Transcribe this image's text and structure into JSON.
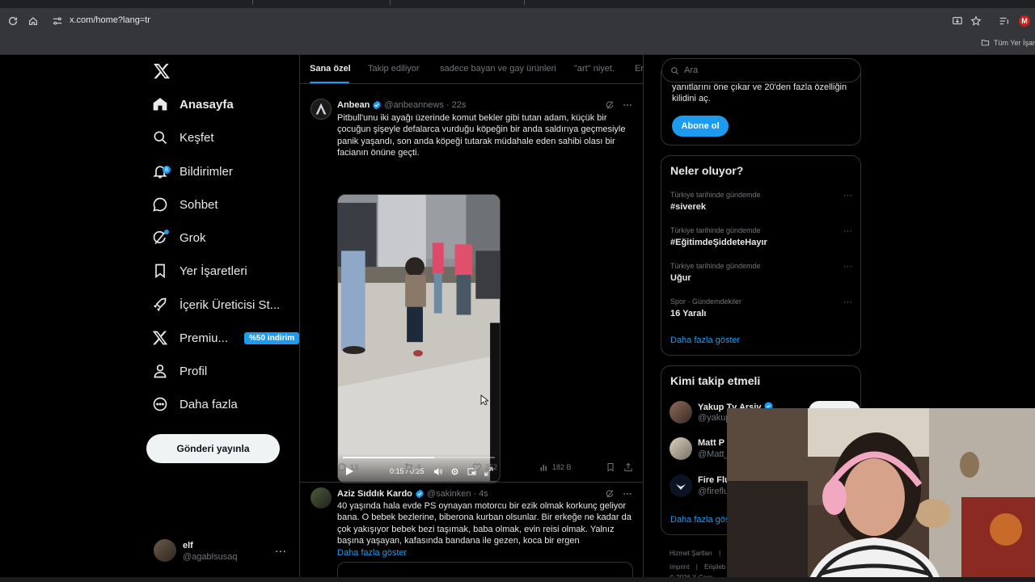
{
  "browser": {
    "url": "x.com/home?lang=tr",
    "bookmarks_all": "Tüm Yer İşar",
    "profile_initial": "M"
  },
  "nav": {
    "items": [
      {
        "label": "Anasayfa",
        "icon": "home-icon",
        "active": true
      },
      {
        "label": "Keşfet",
        "icon": "search-icon"
      },
      {
        "label": "Bildirimler",
        "icon": "bell-icon",
        "badge": "8"
      },
      {
        "label": "Sohbet",
        "icon": "chat-icon"
      },
      {
        "label": "Grok",
        "icon": "grok-icon"
      },
      {
        "label": "Yer İşaretleri",
        "icon": "bookmark-icon"
      },
      {
        "label": "İçerik Üreticisi St...",
        "icon": "rocket-icon"
      },
      {
        "label": "Premiu...",
        "icon": "x-icon",
        "badge_text": "%50 indirim"
      },
      {
        "label": "Profil",
        "icon": "person-icon"
      },
      {
        "label": "Daha fazla",
        "icon": "more-circle-icon"
      }
    ],
    "post_button": "Gönderi yayınla",
    "account": {
      "name": "elf",
      "handle": "@agablsusaq",
      "more": "···"
    }
  },
  "timeline": {
    "tabs": [
      "Sana özel",
      "Takip ediliyor",
      "sadece bayan ve gay ürünleri",
      "\"art\" niyet.",
      "En"
    ],
    "active_tab": 0,
    "posts": [
      {
        "author": "Anbean",
        "handle": "@anbeannews",
        "time": "22s",
        "text": "Pitbull'unu iki ayağı üzerinde komut bekler gibi tutan adam, küçük bir çocuğun şişeyle defalarca vurduğu köpeğin bir anda saldırıya geçmesiyle panik yaşandı, son anda köpeği tutarak müdahale eden sahibi olası bir facianın önüne geçti.",
        "video": {
          "time": "0:15 / 0:25",
          "progress": 0.6
        },
        "stats": {
          "replies": "13",
          "reposts": "6",
          "likes": "252",
          "views": "182 B"
        }
      },
      {
        "author": "Aziz Sıddık Kardo",
        "handle": "@sakinken",
        "time": "4s",
        "text": "40 yaşında hala evde PS oynayan motorcu bir ezik olmak korkunç geliyor bana. O bebek bezlerine, biberona kurban olsunlar. Bir erkeğe ne kadar da çok yakışıyor bebek bezi taşımak, baba olmak, evin reisi olmak. Yalnız başına yaşayan, kafasında bandana ile gezen, koca bir ergen",
        "show_more": "Daha fazla göster"
      }
    ]
  },
  "sidebar": {
    "search_placeholder": "Ara",
    "premium": {
      "text": "yanıtlarını öne çıkar ve 20'den fazla özelliğin kilidini aç.",
      "button": "Abone ol"
    },
    "trends": {
      "title": "Neler oluyor?",
      "items": [
        {
          "context": "Türkiye tarihinde gündemde",
          "topic": "#siverek"
        },
        {
          "context": "Türkiye tarihinde gündemde",
          "topic": "#EğitimdeŞiddeteHayır"
        },
        {
          "context": "Türkiye tarihinde gündemde",
          "topic": "Uğur"
        },
        {
          "context": "Spor · Gündemdekiler",
          "topic": "16 Yaralı"
        }
      ],
      "show_more": "Daha fazla göster"
    },
    "who_to_follow": {
      "title": "Kimi takip etmeli",
      "items": [
        {
          "name": "Yakup Tv Arşiv",
          "handle": "@yakup"
        },
        {
          "name": "Matt P",
          "handle": "@Matt_"
        },
        {
          "name": "Fire Flu",
          "handle": "@fireflu"
        }
      ],
      "show_more": "Daha fazla gös"
    },
    "footer": {
      "links": [
        "Hizmet Şartları",
        "|",
        "Imprint",
        "|",
        "Erişileb"
      ],
      "copyright": "© 2026 X Corp."
    }
  }
}
